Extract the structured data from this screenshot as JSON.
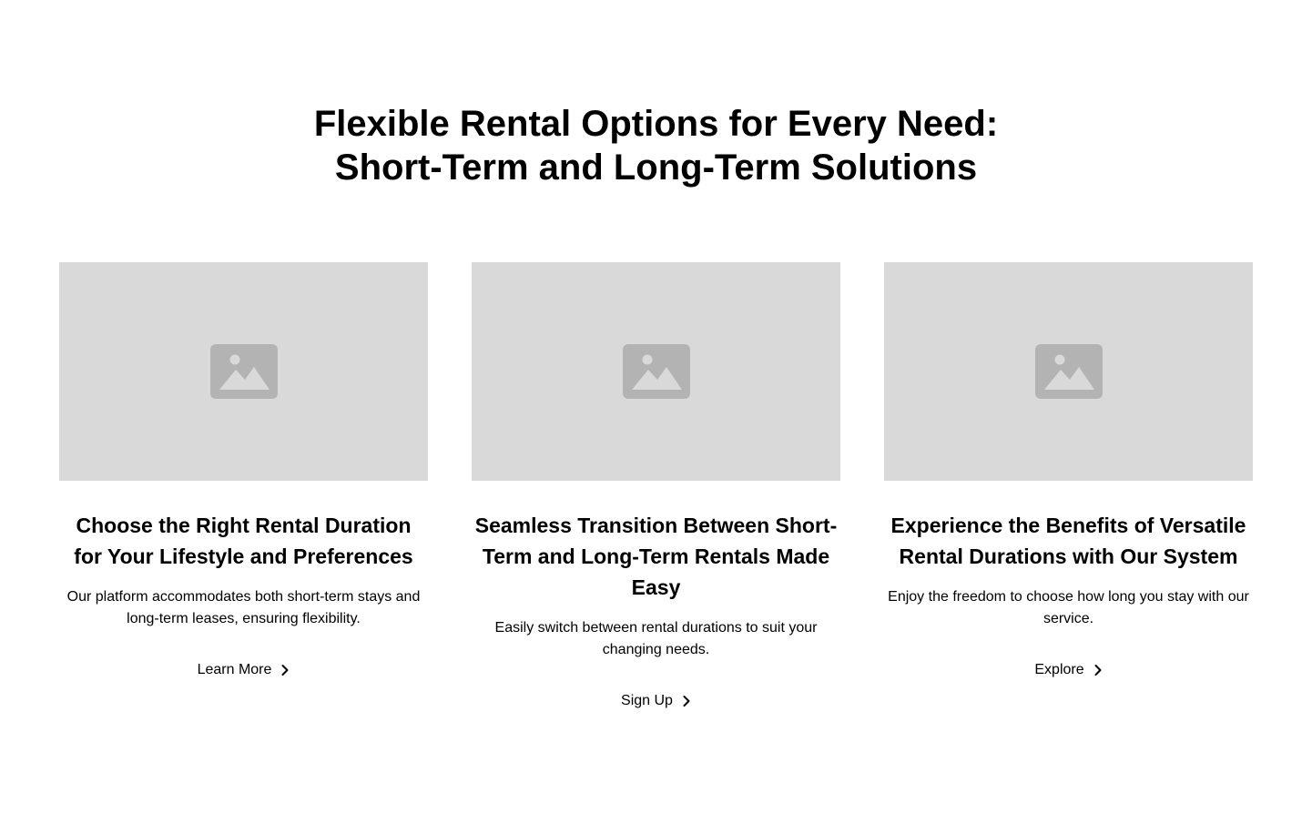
{
  "header": {
    "title_line1": "Flexible Rental Options for Every Need:",
    "title_line2": "Short-Term and Long-Term Solutions"
  },
  "cards": [
    {
      "title": "Choose the Right Rental Duration for Your Lifestyle and Preferences",
      "text": "Our platform accommodates both short-term stays and long-term leases, ensuring flexibility.",
      "link": "Learn More",
      "icon": "image-placeholder-icon"
    },
    {
      "title": "Seamless Transition Between Short-Term and Long-Term Rentals Made Easy",
      "text": "Easily switch between rental durations to suit your changing needs.",
      "link": "Sign Up",
      "icon": "image-placeholder-icon"
    },
    {
      "title": "Experience the Benefits of Versatile Rental Durations with Our System",
      "text": "Enjoy the freedom to choose how long you stay with our service.",
      "link": "Explore",
      "icon": "image-placeholder-icon"
    }
  ],
  "colors": {
    "placeholder_bg": "#d9d9d9",
    "placeholder_icon": "#b3b3b3",
    "text": "#000000"
  }
}
